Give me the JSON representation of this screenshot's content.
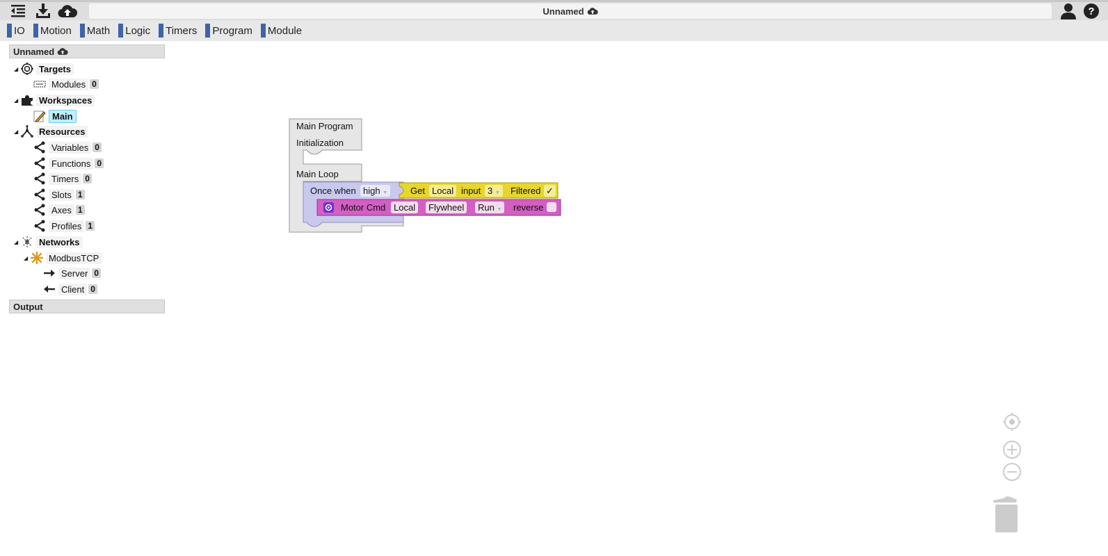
{
  "header": {
    "title": "Unnamed"
  },
  "categories": [
    {
      "label": "IO"
    },
    {
      "label": "Motion"
    },
    {
      "label": "Math"
    },
    {
      "label": "Logic"
    },
    {
      "label": "Timers"
    },
    {
      "label": "Program"
    },
    {
      "label": "Module"
    }
  ],
  "sidebar": {
    "project_title": "Unnamed",
    "targets": {
      "label": "Targets"
    },
    "modules": {
      "label": "Modules",
      "count": "0"
    },
    "workspaces": {
      "label": "Workspaces"
    },
    "main": {
      "label": "Main"
    },
    "resources": {
      "label": "Resources"
    },
    "variables": {
      "label": "Variables",
      "count": "0"
    },
    "functions": {
      "label": "Functions",
      "count": "0"
    },
    "timers": {
      "label": "Timers",
      "count": "0"
    },
    "slots": {
      "label": "Slots",
      "count": "1"
    },
    "axes": {
      "label": "Axes",
      "count": "1"
    },
    "profiles": {
      "label": "Profiles",
      "count": "1"
    },
    "networks": {
      "label": "Networks"
    },
    "modbus": {
      "label": "ModbusTCP"
    },
    "server": {
      "label": "Server",
      "count": "0"
    },
    "client": {
      "label": "Client",
      "count": "0"
    },
    "output": "Output"
  },
  "program": {
    "title": "Main Program",
    "init_label": "Initialization",
    "loop_label": "Main Loop",
    "once_when": "Once when",
    "edge": "high",
    "get": "Get",
    "get_scope": "Local",
    "input_label": "input",
    "input_num": "3",
    "filtered": "Filtered",
    "check": "✓",
    "motor_cmd": "Motor Cmd",
    "motor_scope": "Local",
    "motor_axis": "Flywheel",
    "motor_action": "Run",
    "reverse": "reverse"
  },
  "colors": {
    "category_mark": "#3e64a6",
    "program_block": "#e6e6e6",
    "once_block": "#c9c9ee",
    "get_block": "#e6d62e",
    "motor_block": "#d35fc3",
    "selected": "#bfefff"
  },
  "icons": [
    "menu-collapse-icon",
    "download-icon",
    "cloud-upload-icon",
    "user-icon",
    "help-icon",
    "target-icon",
    "module-icon",
    "puzzle-icon",
    "pencil-icon",
    "resources-icon",
    "share-icon",
    "network-icon",
    "modbus-icon",
    "arrow-right-icon",
    "arrow-left-icon",
    "recenter-icon",
    "zoom-in-icon",
    "zoom-out-icon",
    "trash-icon"
  ]
}
